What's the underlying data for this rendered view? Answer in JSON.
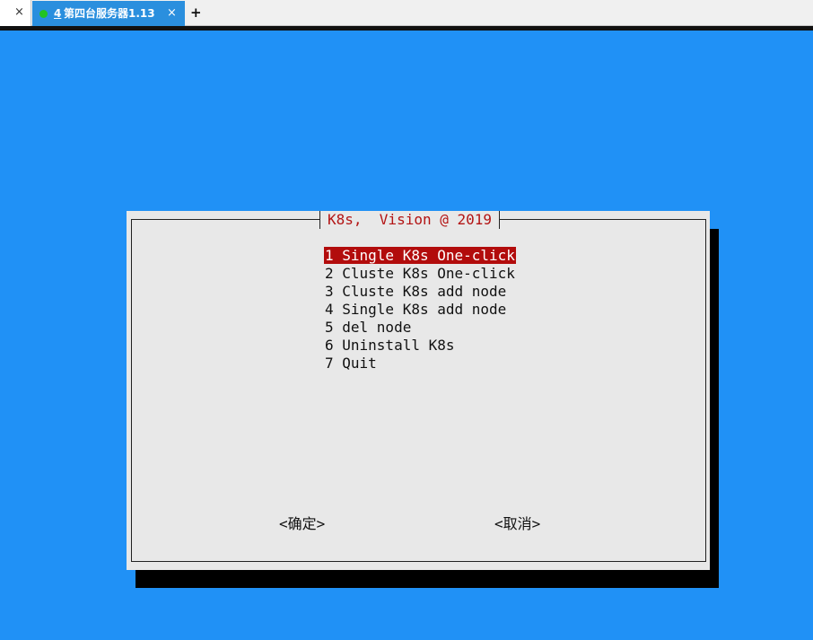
{
  "tabs": {
    "previous_close": "×",
    "active": {
      "number": "4",
      "label": "第四台服务器1.13",
      "close": "×"
    },
    "new_tab": "+"
  },
  "dialog": {
    "title": "K8s,  Vision @ 2019",
    "menu": [
      "1 Single K8s One-click",
      "2 Cluste K8s One-click",
      "3 Cluste K8s add node",
      "4 Single K8s add node",
      "5 del node",
      "6 Uninstall K8s",
      "7 Quit"
    ],
    "selected_index": 0,
    "ok_label": "<确定>",
    "cancel_label": "<取消>"
  },
  "colors": {
    "terminal_bg": "#2091f6",
    "dialog_bg": "#e8e8e8",
    "highlight": "#b20c0c",
    "title_text": "#b31414",
    "tab_active_bg": "#2a8fde",
    "status_dot": "#22c322"
  }
}
